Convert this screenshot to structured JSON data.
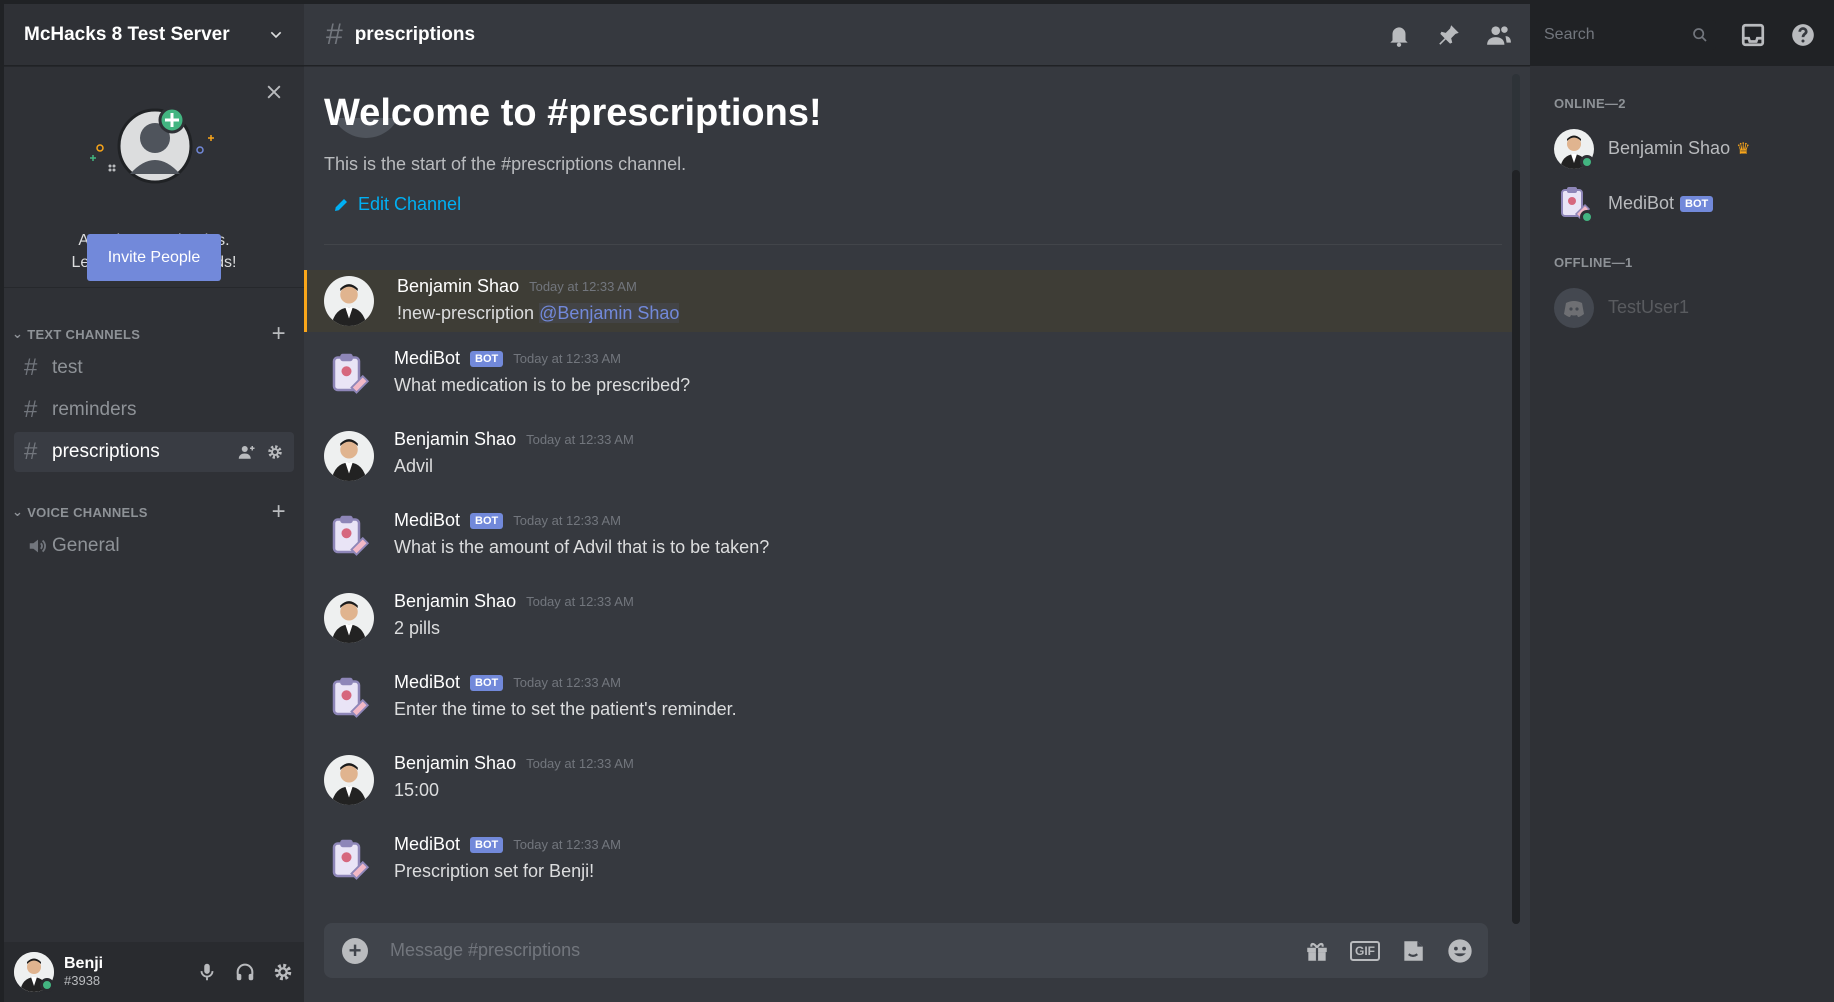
{
  "server": {
    "name": "McHacks 8 Test Server"
  },
  "invite": {
    "line1": "An adventure begins.",
    "line2": "Let's add some friends!",
    "button": "Invite People"
  },
  "categories": {
    "text": "TEXT CHANNELS",
    "voice": "VOICE CHANNELS"
  },
  "channels": {
    "text": [
      "test",
      "reminders",
      "prescriptions"
    ],
    "voice": [
      "General"
    ],
    "active": "prescriptions"
  },
  "user": {
    "name": "Benji",
    "tag": "#3938"
  },
  "topbar": {
    "channel": "prescriptions",
    "search_placeholder": "Search"
  },
  "welcome": {
    "title": "Welcome to #prescriptions!",
    "subtitle": "This is the start of the #prescriptions channel.",
    "edit": "Edit Channel"
  },
  "messages": [
    {
      "author": "Benjamin Shao",
      "bot": false,
      "time": "Today at 12:33 AM",
      "text": "!new-prescription ",
      "mention": "@Benjamin Shao",
      "highlight": true
    },
    {
      "author": "MediBot",
      "bot": true,
      "time": "Today at 12:33 AM",
      "text": "What medication is to be prescribed?"
    },
    {
      "author": "Benjamin Shao",
      "bot": false,
      "time": "Today at 12:33 AM",
      "text": "Advil"
    },
    {
      "author": "MediBot",
      "bot": true,
      "time": "Today at 12:33 AM",
      "text": "What is the amount of Advil that is to be taken?"
    },
    {
      "author": "Benjamin Shao",
      "bot": false,
      "time": "Today at 12:33 AM",
      "text": "2 pills"
    },
    {
      "author": "MediBot",
      "bot": true,
      "time": "Today at 12:33 AM",
      "text": "Enter the time to set the patient's reminder."
    },
    {
      "author": "Benjamin Shao",
      "bot": false,
      "time": "Today at 12:33 AM",
      "text": "15:00"
    },
    {
      "author": "MediBot",
      "bot": true,
      "time": "Today at 12:33 AM",
      "text": "Prescription set for Benji!"
    }
  ],
  "bot_tag": "BOT",
  "composer": {
    "placeholder": "Message #prescriptions",
    "gif": "GIF"
  },
  "members": {
    "online_label": "ONLINE—2",
    "offline_label": "OFFLINE—1",
    "online": [
      "Benjamin Shao",
      "MediBot"
    ],
    "offline": [
      "TestUser1"
    ]
  },
  "colors": {
    "accent": "#7289da",
    "online": "#43b581",
    "link": "#00b0f4",
    "mention_bar": "#faa61a"
  }
}
